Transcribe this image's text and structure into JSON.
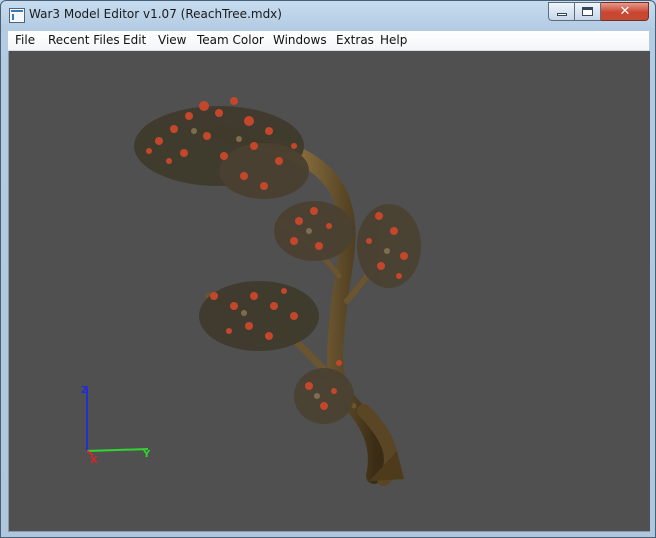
{
  "window": {
    "title": "War3 Model Editor v1.07 (ReachTree.mdx)",
    "close_glyph": "✕"
  },
  "menu": {
    "items": [
      "File",
      "Recent Files",
      "Edit",
      "View",
      "Team Color",
      "Windows",
      "Extras",
      "Help"
    ]
  },
  "viewport": {
    "background": "#505050",
    "axes": {
      "z_label": "Z",
      "y_label": "Y",
      "x_label": "X"
    },
    "colors": {
      "z": "#1f2fd6",
      "y": "#2fd62f",
      "x": "#d62828"
    }
  }
}
